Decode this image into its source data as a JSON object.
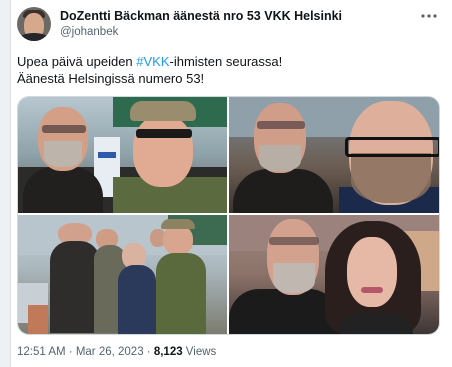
{
  "tweet": {
    "display_name": "DoZentti Bäckman äänestä nro 53 VKK Helsinki",
    "handle": "@johanbek",
    "text_line1_before": "Upea päivä upeiden ",
    "hashtag": "#VKK",
    "text_line1_after": "-ihmisten seurassa!",
    "text_line2": "Äänestä Helsingissä numero 53!",
    "time": "12:51 AM",
    "dot1": " · ",
    "date": "Mar 26, 2023",
    "dot2": " · ",
    "views_count": "8,123",
    "views_label": " Views"
  },
  "media": {
    "photo_count": 4
  },
  "colors": {
    "accent": "#1d9bf0",
    "secondary_text": "#536471",
    "primary_text": "#0f1419"
  },
  "icons": {
    "more": "more-horizontal-icon"
  }
}
